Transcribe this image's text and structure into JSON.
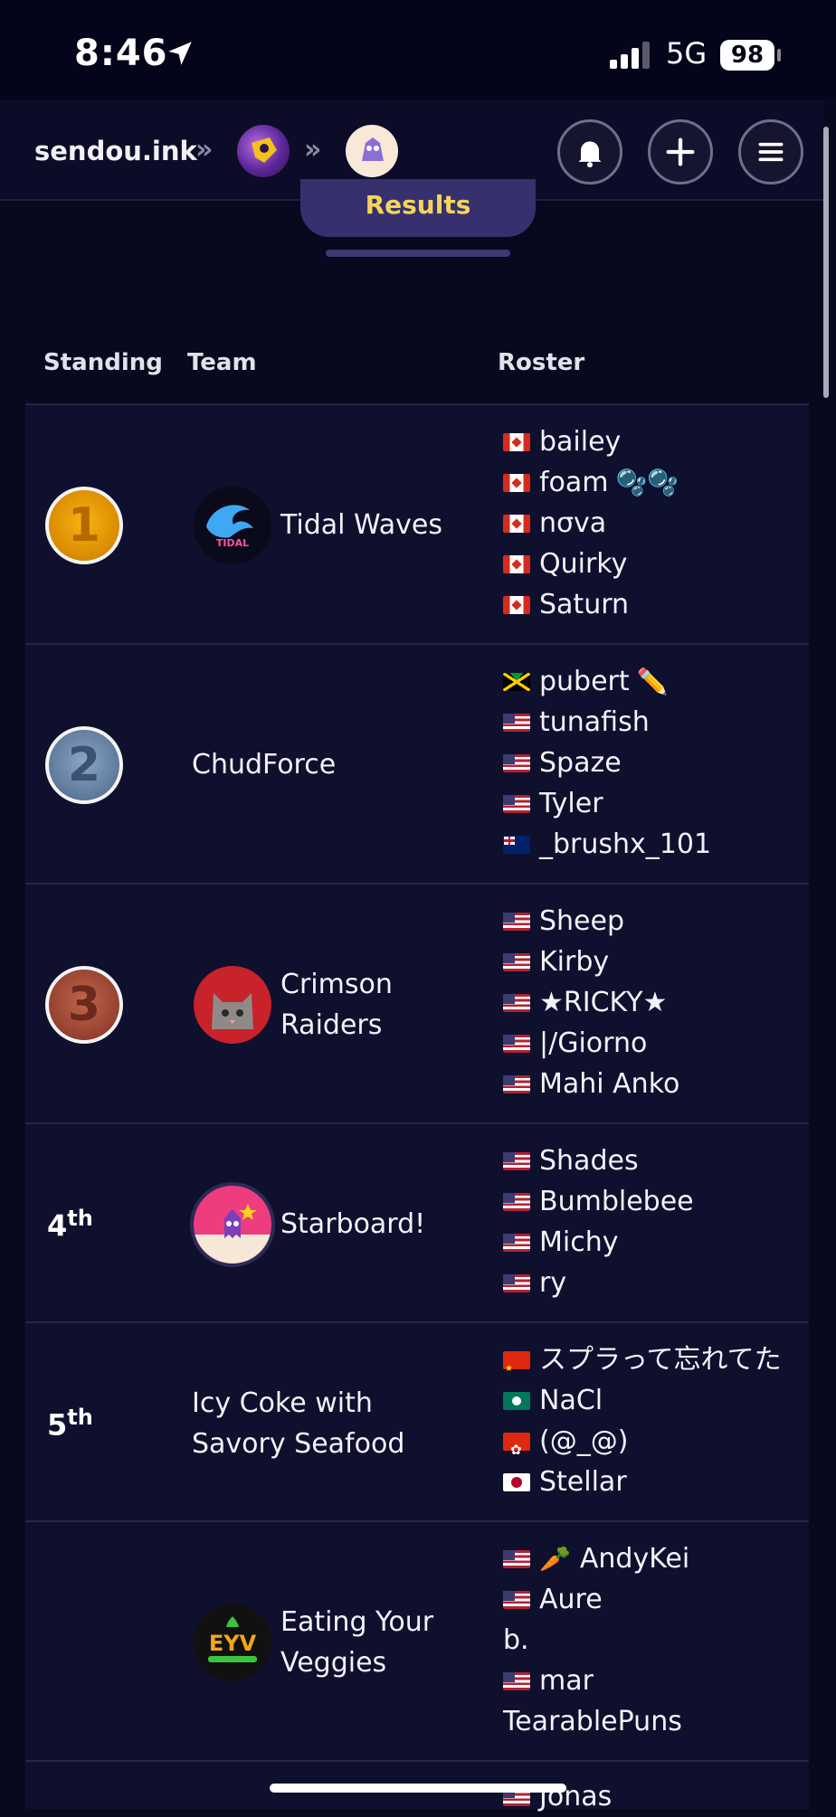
{
  "status_bar": {
    "time": "8:46",
    "network": "5G",
    "battery": "98"
  },
  "nav": {
    "site": "sendou.ink",
    "separator": "»"
  },
  "tab": {
    "label": "Results"
  },
  "table": {
    "headers": [
      "Standing",
      "Team",
      "Roster"
    ],
    "rows": [
      {
        "medal": "1",
        "team": "Tidal Waves",
        "roster": [
          {
            "flag": "ca",
            "name": "bailey"
          },
          {
            "flag": "ca",
            "name": "foam",
            "emoji": "🫧🫧"
          },
          {
            "flag": "ca",
            "name": "nσva"
          },
          {
            "flag": "ca",
            "name": "Quirky"
          },
          {
            "flag": "ca",
            "name": "Saturn"
          }
        ]
      },
      {
        "medal": "2",
        "team": "ChudForce",
        "roster": [
          {
            "flag": "jm",
            "name": "pubert",
            "emoji": "✏️"
          },
          {
            "flag": "us",
            "name": "tunafish"
          },
          {
            "flag": "us",
            "name": "Spaze"
          },
          {
            "flag": "us",
            "name": "Tyler"
          },
          {
            "flag": "au",
            "name": "_brushx_101"
          }
        ]
      },
      {
        "medal": "3",
        "team_line1": "Crimson",
        "team_line2": "Raiders",
        "roster": [
          {
            "flag": "us",
            "name": "Sheep"
          },
          {
            "flag": "us",
            "name": "Kirby"
          },
          {
            "flag": "us",
            "name": "★RICKY★"
          },
          {
            "flag": "us",
            "name": "|/Giorno"
          },
          {
            "flag": "us",
            "name": "Mahi Anko"
          }
        ]
      },
      {
        "place": "4",
        "suffix": "th",
        "team": "Starboard!",
        "roster": [
          {
            "flag": "us",
            "name": "Shades"
          },
          {
            "flag": "us",
            "name": "Bumblebee"
          },
          {
            "flag": "us",
            "name": "Michy"
          },
          {
            "flag": "us",
            "name": "ry"
          }
        ]
      },
      {
        "place": "5",
        "suffix": "th",
        "team_line1": "Icy Coke with",
        "team_line2": "Savory Seafood",
        "roster": [
          {
            "flag": "cn",
            "name": "スプラって忘れてた"
          },
          {
            "flag": "mo",
            "name": "NaCl"
          },
          {
            "flag": "hk",
            "name": "(@_@)"
          },
          {
            "flag": "jp",
            "name": "Stellar"
          }
        ]
      },
      {
        "team_line1": "Eating Your",
        "team_line2": "Veggies",
        "roster": [
          {
            "flag": "us",
            "name": "AndyKei",
            "emoji": "🥕"
          },
          {
            "flag": "us",
            "name": "Aure"
          },
          {
            "name": "b."
          },
          {
            "flag": "us",
            "name": "mar"
          },
          {
            "name": "TearablePuns"
          }
        ]
      },
      {
        "roster": [
          {
            "flag": "us",
            "name": "Jonas"
          }
        ]
      }
    ]
  },
  "colors": {
    "background": "#08081f",
    "row": "#0f0f2e",
    "tab_text": "#f2d55a",
    "tab_bg": "#36306e"
  },
  "icons": [
    "location-arrow-icon",
    "signal-icon",
    "bell-icon",
    "plus-icon",
    "menu-icon"
  ]
}
